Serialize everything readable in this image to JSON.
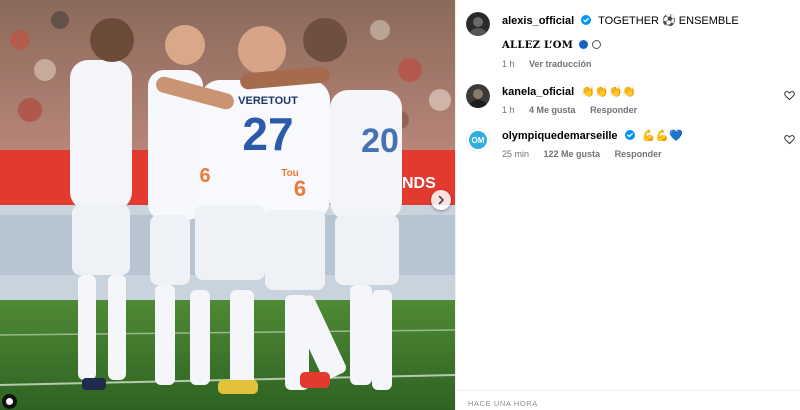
{
  "post": {
    "author": {
      "username": "alexis_official",
      "caption_inline": "TOGETHER ⚽ ENSEMBLE",
      "caption_line2": "ALLEZ L’OM",
      "time": "1 h",
      "translate": "Ver traducción"
    },
    "photo": {
      "jersey_name": "VERETOUT",
      "jersey_number": "27",
      "jersey_number_2": "20",
      "sponsor": "Tou",
      "board_text": "NDS",
      "alt": "team-celebration-photo"
    },
    "footer_time": "HACE UNA HORA"
  },
  "comments": [
    {
      "username": "kanela_oficial",
      "text": "👏👏👏👏",
      "time": "1 h",
      "likes": "4 Me gusta",
      "reply": "Responder",
      "verified": false
    },
    {
      "username": "olympiquedemarseille",
      "text": "💪💪💙",
      "time": "25 min",
      "likes": "122 Me gusta",
      "reply": "Responder",
      "verified": true
    }
  ],
  "colors": {
    "verified": "#0095f6",
    "om_blue": "#2faee0",
    "meta_gray": "#737373"
  },
  "icons": {
    "verified": "verified-badge-icon",
    "heart": "heart-outline-icon",
    "next": "chevron-right-icon"
  }
}
